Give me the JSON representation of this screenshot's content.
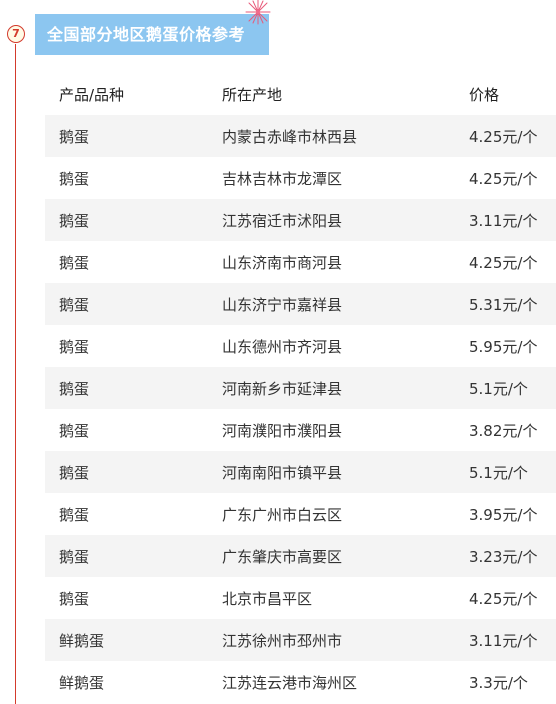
{
  "section": {
    "number": "7",
    "title": "全国部分地区鹅蛋价格参考"
  },
  "colors": {
    "accent": "#d33a2c",
    "title_bg": "#8cc6f0",
    "row_alt_bg": "#f4f4f4"
  },
  "table": {
    "headers": [
      "产品/品种",
      "所在产地",
      "价格"
    ],
    "rows": [
      {
        "product": "鹅蛋",
        "region": "内蒙古赤峰市林西县",
        "price": "4.25元/个"
      },
      {
        "product": "鹅蛋",
        "region": "吉林吉林市龙潭区",
        "price": "4.25元/个"
      },
      {
        "product": "鹅蛋",
        "region": "江苏宿迁市沭阳县",
        "price": "3.11元/个"
      },
      {
        "product": "鹅蛋",
        "region": "山东济南市商河县",
        "price": "4.25元/个"
      },
      {
        "product": "鹅蛋",
        "region": "山东济宁市嘉祥县",
        "price": "5.31元/个"
      },
      {
        "product": "鹅蛋",
        "region": "山东德州市齐河县",
        "price": "5.95元/个"
      },
      {
        "product": "鹅蛋",
        "region": "河南新乡市延津县",
        "price": "5.1元/个"
      },
      {
        "product": "鹅蛋",
        "region": "河南濮阳市濮阳县",
        "price": "3.82元/个"
      },
      {
        "product": "鹅蛋",
        "region": "河南南阳市镇平县",
        "price": "5.1元/个"
      },
      {
        "product": "鹅蛋",
        "region": "广东广州市白云区",
        "price": "3.95元/个"
      },
      {
        "product": "鹅蛋",
        "region": "广东肇庆市高要区",
        "price": "3.23元/个"
      },
      {
        "product": "鹅蛋",
        "region": "北京市昌平区",
        "price": "4.25元/个"
      },
      {
        "product": "鲜鹅蛋",
        "region": "江苏徐州市邳州市",
        "price": "3.11元/个"
      },
      {
        "product": "鲜鹅蛋",
        "region": "江苏连云港市海州区",
        "price": "3.3元/个"
      }
    ]
  }
}
